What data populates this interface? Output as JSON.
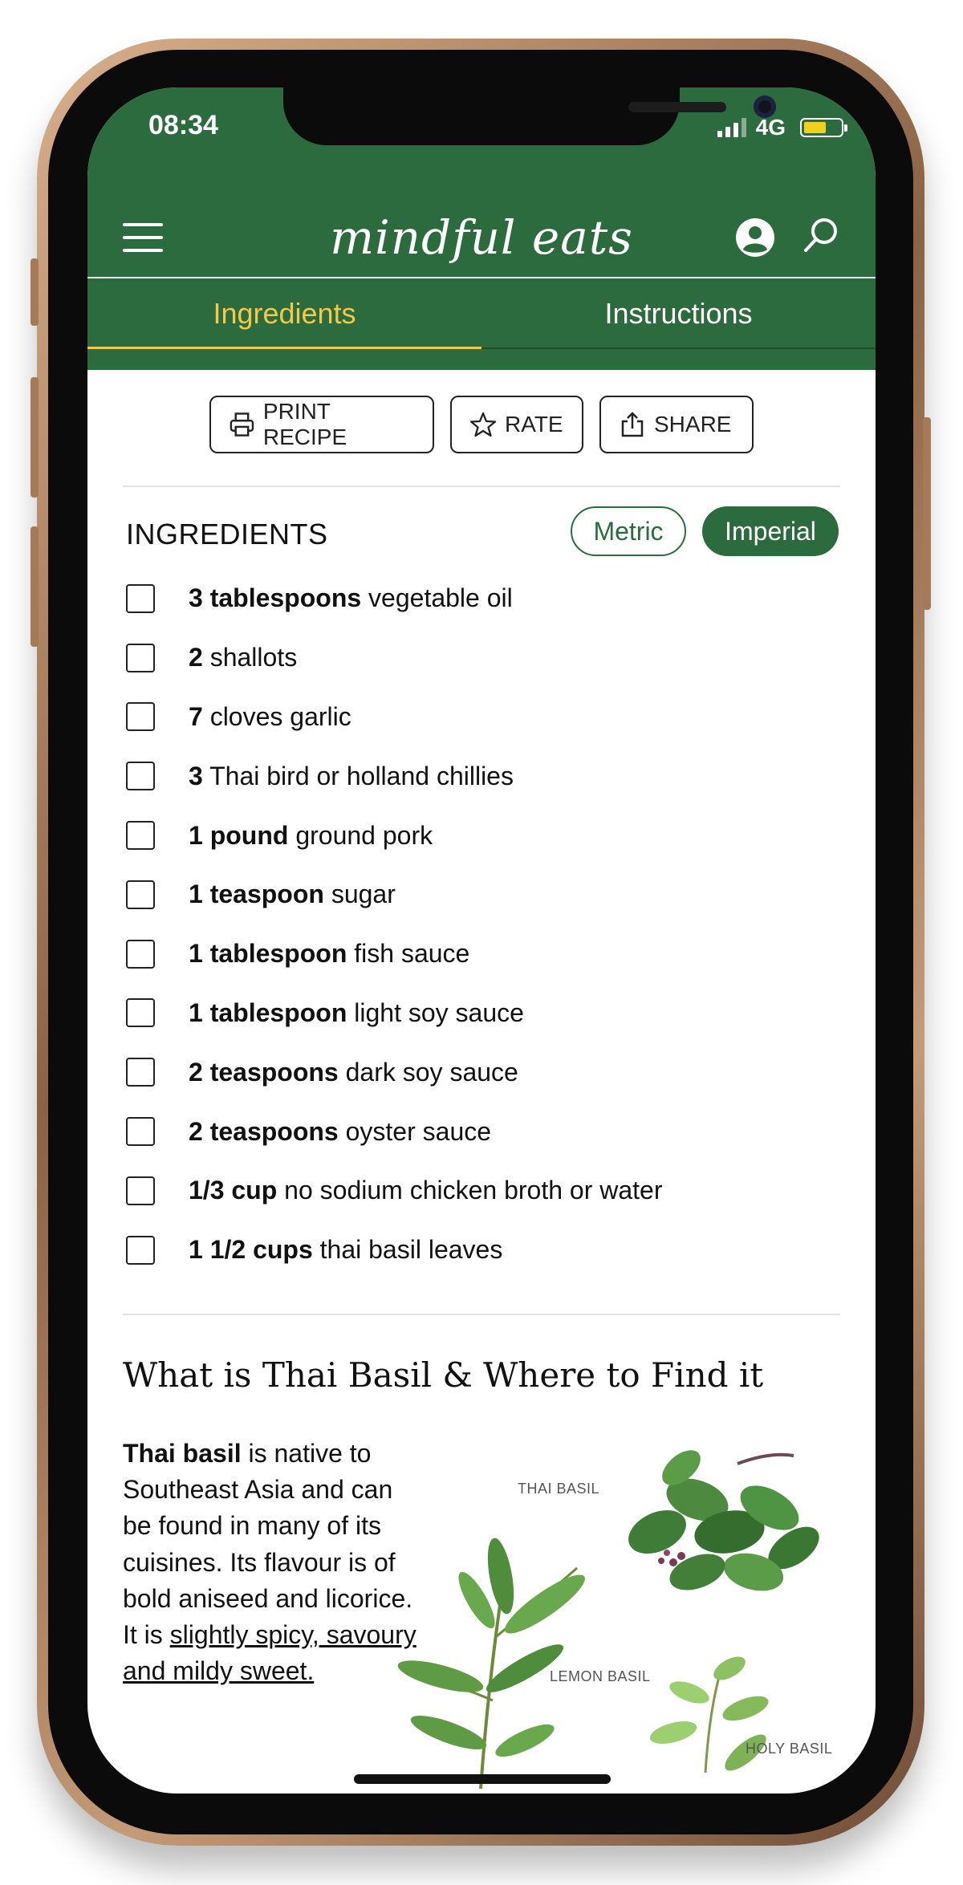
{
  "status_bar": {
    "time": "08:34",
    "network": "4G"
  },
  "header": {
    "logo": "mindful eats"
  },
  "tabs": [
    {
      "label": "Ingredients",
      "active": true
    },
    {
      "label": "Instructions",
      "active": false
    }
  ],
  "actions": {
    "print": "PRINT RECIPE",
    "rate": "RATE",
    "share": "SHARE"
  },
  "ingredients_section": {
    "heading": "INGREDIENTS",
    "unit_options": [
      "Metric",
      "Imperial"
    ],
    "selected_unit": "Imperial",
    "items": [
      {
        "qty": "3 tablespoons",
        "name": "vegetable oil"
      },
      {
        "qty": "2",
        "name": "shallots"
      },
      {
        "qty": "7",
        "name": "cloves garlic"
      },
      {
        "qty": "3",
        "name": "Thai bird or holland chillies"
      },
      {
        "qty": "1 pound",
        "name": "ground pork"
      },
      {
        "qty": "1 teaspoon",
        "name": "sugar"
      },
      {
        "qty": "1 tablespoon",
        "name": "fish sauce"
      },
      {
        "qty": "1 tablespoon",
        "name": "light soy sauce"
      },
      {
        "qty": "2 teaspoons",
        "name": "dark soy sauce"
      },
      {
        "qty": "2 teaspoons",
        "name": "oyster sauce"
      },
      {
        "qty": "1/3 cup",
        "name": "no sodium chicken broth or water"
      },
      {
        "qty": "1 1/2 cups",
        "name": "thai basil leaves"
      }
    ]
  },
  "article": {
    "title": "What is Thai Basil & Where to Find it",
    "bold_lead": "Thai basil",
    "body": " is native to Southeast Asia and can be found in many of its cuisines. Its flavour is of bold aniseed and licorice. It is ",
    "link_text": "slightly spicy, savoury and mildy sweet."
  },
  "illustration": {
    "labels": {
      "thai": "THAI BASIL",
      "lemon": "LEMON BASIL",
      "holy": "HOLY BASIL"
    }
  },
  "colors": {
    "brand_green": "#2c6b3d",
    "tab_active": "#f2c94c",
    "battery": "#f0d020"
  }
}
